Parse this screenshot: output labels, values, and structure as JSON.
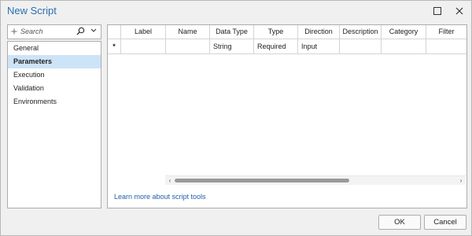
{
  "window": {
    "title": "New Script"
  },
  "sidebar": {
    "search_placeholder": "Search",
    "items": [
      {
        "label": "General"
      },
      {
        "label": "Parameters"
      },
      {
        "label": "Execution"
      },
      {
        "label": "Validation"
      },
      {
        "label": "Environments"
      }
    ],
    "selected": "Parameters"
  },
  "grid": {
    "columns": [
      "",
      "Label",
      "Name",
      "Data Type",
      "Type",
      "Direction",
      "Description",
      "Category",
      "Filter"
    ],
    "rows": [
      [
        "*",
        "",
        "",
        "String",
        "Required",
        "Input",
        "",
        "",
        ""
      ]
    ]
  },
  "links": {
    "learn_more": "Learn more about script tools"
  },
  "buttons": {
    "ok": "OK",
    "cancel": "Cancel"
  },
  "colors": {
    "title": "#2a6fb0",
    "selection": "#cde3f7",
    "link": "#1f5faa"
  }
}
